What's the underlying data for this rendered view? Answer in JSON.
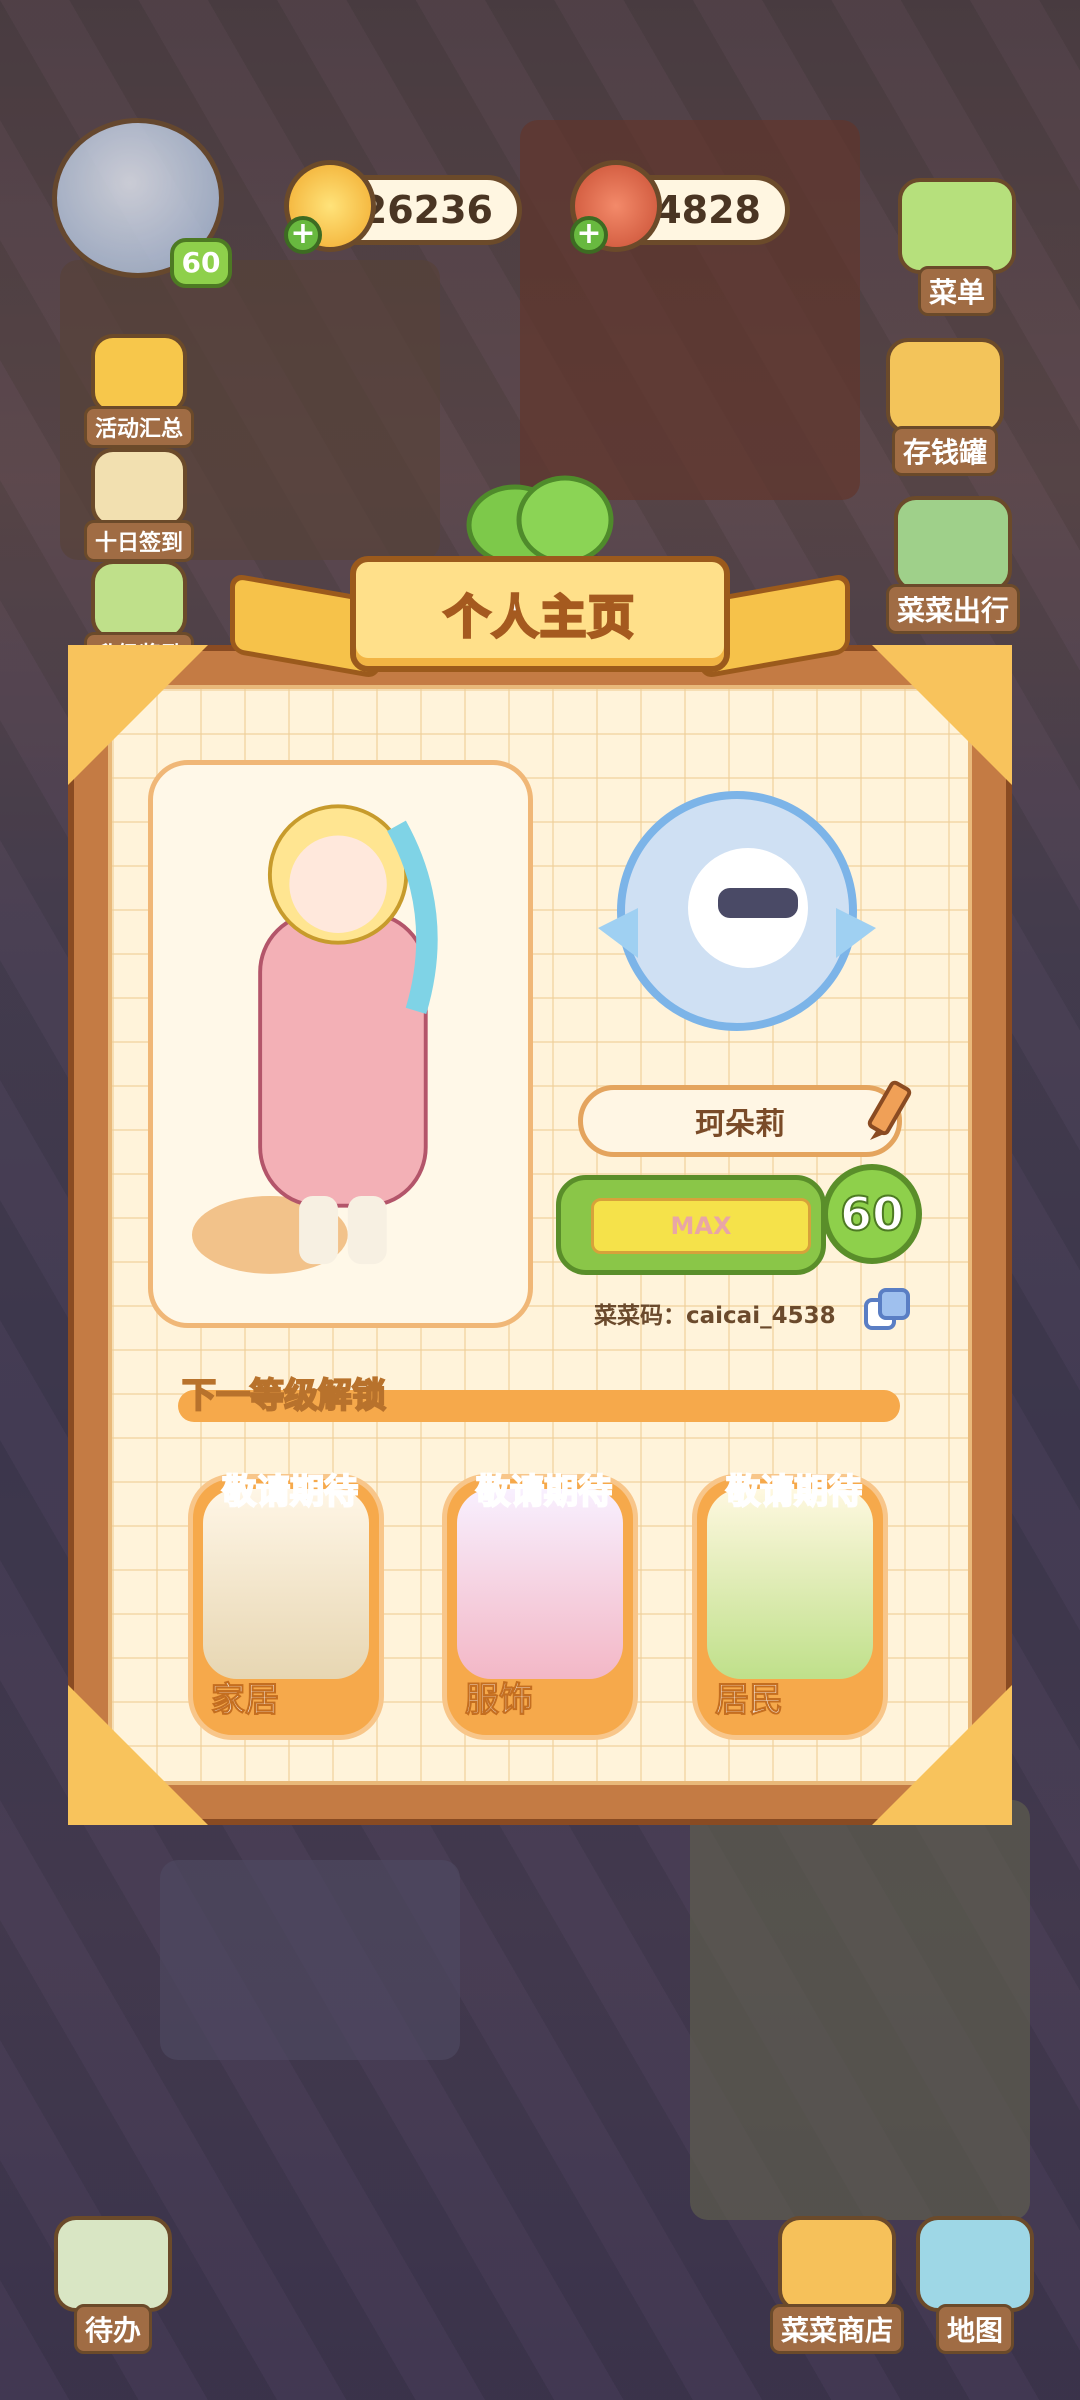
{
  "hud": {
    "level": "60",
    "coins": "26236",
    "veggies": "4828",
    "menu_label": "菜单",
    "piggy_label": "存钱罐",
    "travel_label": "菜菜出行",
    "events_label": "活动汇总",
    "signin_label": "十日签到",
    "upgrade_label": "升级奖励"
  },
  "profile": {
    "title": "个人主页",
    "name": "珂朵莉",
    "level_text": "MAX",
    "level": "60",
    "code": "菜菜码：caicai_4538",
    "unlock_title": "下一等级解锁",
    "unlock_items": [
      {
        "tag": "敬请期待",
        "label": "家居"
      },
      {
        "tag": "敬请期待",
        "label": "服饰"
      },
      {
        "tag": "敬请期待",
        "label": "居民"
      }
    ]
  },
  "bottom": {
    "todo_label": "待办",
    "shop_label": "菜菜商店",
    "map_label": "地图"
  }
}
